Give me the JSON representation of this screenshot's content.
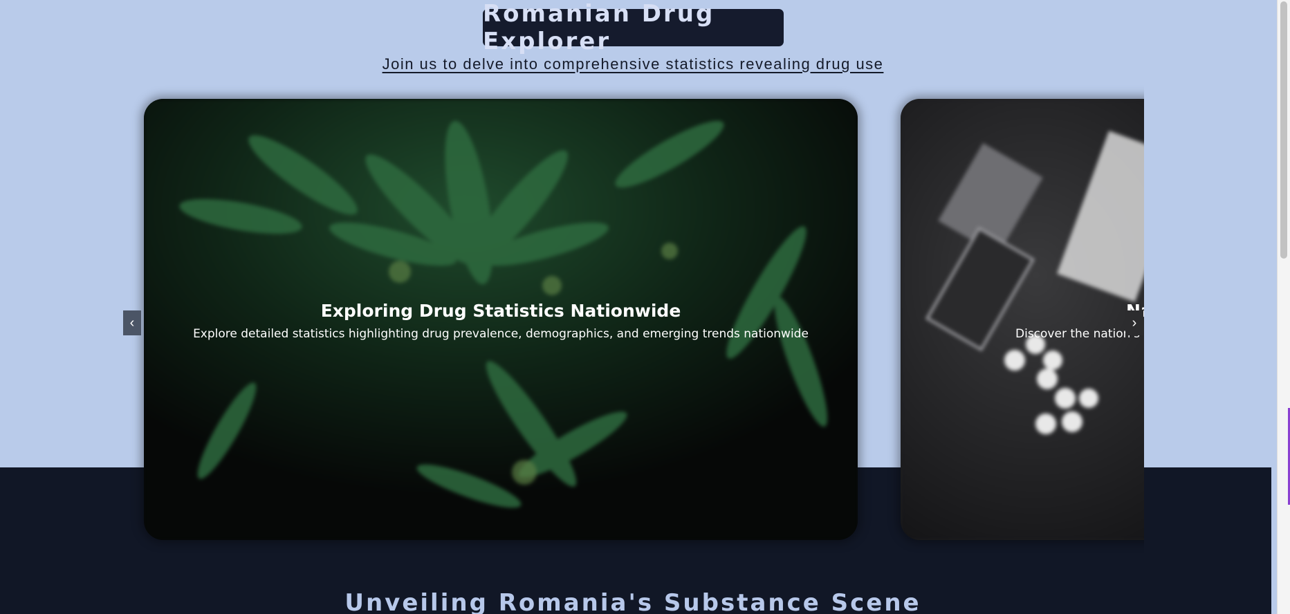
{
  "header": {
    "title": "Romanian Drug Explorer",
    "subtitle": "Join us to delve into comprehensive statistics revealing drug use"
  },
  "carousel": {
    "prev_label": "‹",
    "next_label": "›",
    "slides": [
      {
        "title": "Exploring Drug Statistics Nationwide",
        "text": "Explore detailed statistics highlighting drug prevalence, demographics, and emerging trends nationwide"
      },
      {
        "title": "Na",
        "text": "Discover the nation's su"
      }
    ]
  },
  "section": {
    "heading": "Unveiling Romania's Substance Scene"
  },
  "colors": {
    "page_bg": "#b9cbea",
    "dark_band": "#111726",
    "title_pill": "#151b2d",
    "heading_text": "#b7c8ea"
  }
}
